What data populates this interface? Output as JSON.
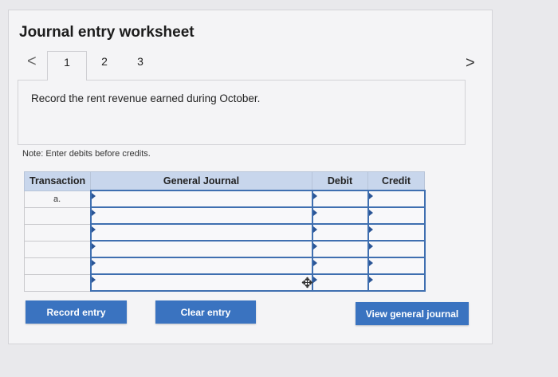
{
  "header": {
    "title": "Journal entry worksheet"
  },
  "nav": {
    "prev": "<",
    "next": ">"
  },
  "tabs": [
    {
      "label": "1",
      "active": true
    },
    {
      "label": "2",
      "active": false
    },
    {
      "label": "3",
      "active": false
    }
  ],
  "instruction": {
    "text": "Record the rent revenue earned during October."
  },
  "note": {
    "text": "Note: Enter debits before credits."
  },
  "table": {
    "columns": [
      "Transaction",
      "General Journal",
      "Debit",
      "Credit"
    ],
    "rows": [
      {
        "transaction": "a.",
        "account": "",
        "debit": "",
        "credit": ""
      },
      {
        "transaction": "",
        "account": "",
        "debit": "",
        "credit": ""
      },
      {
        "transaction": "",
        "account": "",
        "debit": "",
        "credit": ""
      },
      {
        "transaction": "",
        "account": "",
        "debit": "",
        "credit": ""
      },
      {
        "transaction": "",
        "account": "",
        "debit": "",
        "credit": ""
      },
      {
        "transaction": "",
        "account": "",
        "debit": "",
        "credit": ""
      }
    ]
  },
  "buttons": {
    "record": "Record entry",
    "clear": "Clear entry",
    "view": "View general journal"
  },
  "colors": {
    "accent": "#3a73c0",
    "header_bg": "#c8d6ec",
    "input_border": "#3f6fb0"
  },
  "icons": {
    "cursor": "move-cursor-icon"
  }
}
